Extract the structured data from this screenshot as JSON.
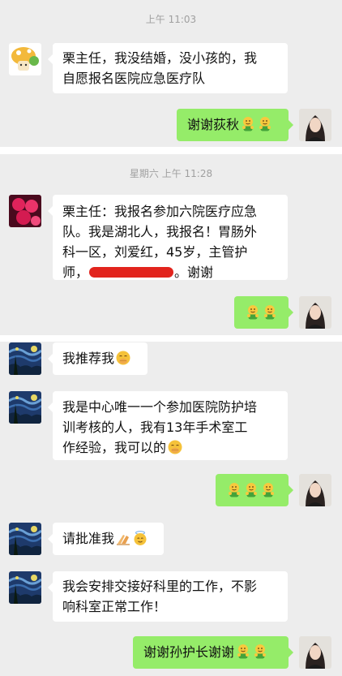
{
  "colors": {
    "panel_bg": "#ededed",
    "bubble_sent": "#95ec69",
    "bubble_received": "#ffffff",
    "redaction": "#e2241d",
    "timestamp": "#a0a0a0"
  },
  "blocks": [
    {
      "timestamp": "上午 11:03",
      "messages": [
        {
          "side": "left",
          "avatar": "mushroom-avatar",
          "text": "栗主任，我没结婚，没小孩的，我\n自愿报名医院应急医疗队"
        },
        {
          "side": "right",
          "avatar": "woman-avatar",
          "text": "谢谢荻秋",
          "emoji": [
            "hug-emoji",
            "hug-emoji"
          ]
        }
      ]
    },
    {
      "timestamp": "星期六 上午 11:28",
      "messages": [
        {
          "side": "left",
          "avatar": "flower-avatar",
          "text_lines": [
            "栗主任：我报名参加六院医疗应急",
            "队。我是湖北人，我报名！胃肠外",
            "科一区，刘爱红，45岁，主管护"
          ],
          "last_line_prefix": "师，",
          "last_line_suffix": "。谢谢"
        },
        {
          "side": "right",
          "avatar": "woman-avatar",
          "text": "",
          "emoji": [
            "hug-emoji",
            "hug-emoji"
          ]
        }
      ]
    },
    {
      "timestamp": "",
      "messages": [
        {
          "side": "left",
          "avatar": "starry-night-avatar",
          "text": "我推荐我",
          "emoji": [
            "shush-emoji"
          ]
        },
        {
          "side": "left",
          "avatar": "starry-night-avatar",
          "text": "我是中心唯一一个参加医院防护培\n训考核的人，我有13年手术室工\n作经验，我可以的",
          "emoji": [
            "shush-emoji"
          ]
        },
        {
          "side": "right",
          "avatar": "woman-avatar",
          "text": "",
          "emoji": [
            "hug-emoji",
            "hug-emoji",
            "hug-emoji"
          ]
        },
        {
          "side": "left",
          "avatar": "starry-night-avatar",
          "text": "请批准我",
          "emoji": [
            "pray-emoji",
            "halo-emoji"
          ]
        },
        {
          "side": "left",
          "avatar": "starry-night-avatar",
          "text": "我会安排交接好科里的工作，不影\n响科室正常工作！"
        },
        {
          "side": "right",
          "avatar": "woman-avatar",
          "text": "谢谢孙护长谢谢",
          "emoji": [
            "hug-emoji",
            "hug-emoji"
          ]
        }
      ]
    }
  ]
}
